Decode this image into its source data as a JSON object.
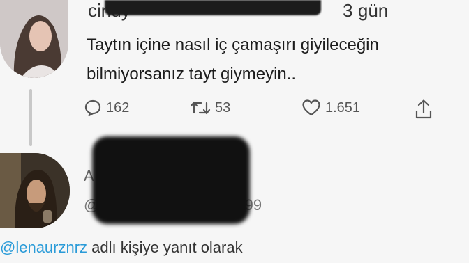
{
  "tweet": {
    "author_name_visible": "cindy",
    "relative_time": "3 gün",
    "text_line1": "Taytın içine nasıl iç çamaşırı giyileceğin",
    "text_line2": "bilmiyorsanız tayt giymeyin..",
    "reply_count": "162",
    "retweet_count": "53",
    "like_count": "1.651"
  },
  "reply_author": {
    "name_partial": "A",
    "handle_partial": "@",
    "handle_suffix": "99"
  },
  "reply_context": {
    "mention": "@lenaurznrz",
    "suffix": " adlı kişiye yanıt olarak"
  },
  "colors": {
    "mention": "#2a9bd8",
    "background": "#f6f6f6",
    "icon": "#555555"
  },
  "icons": [
    "reply-icon",
    "retweet-icon",
    "like-icon",
    "share-icon"
  ]
}
